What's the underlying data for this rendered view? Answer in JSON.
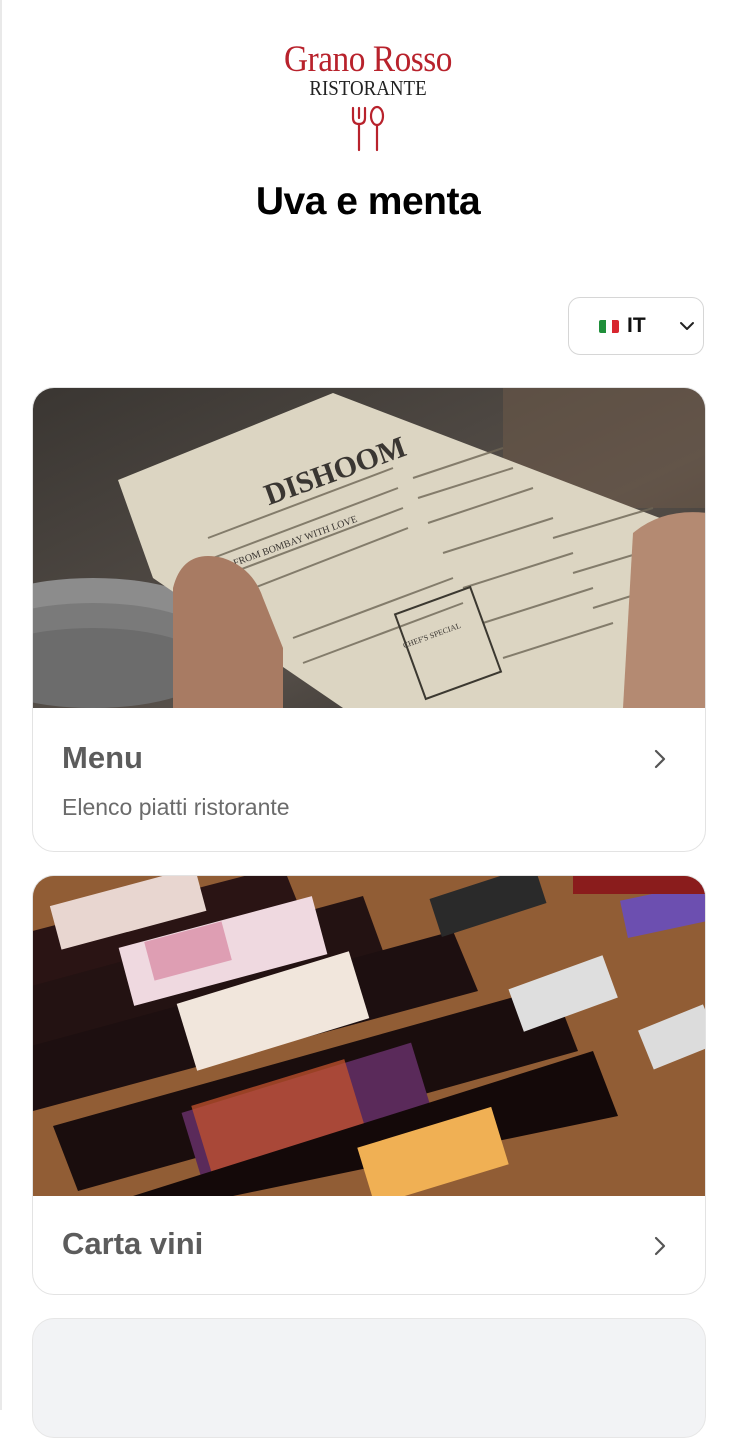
{
  "brand": {
    "name": "Grano Rosso",
    "subtitle": "RISTORANTE",
    "color": "#b8222c"
  },
  "page": {
    "title": "Uva e menta"
  },
  "language": {
    "selected": "IT",
    "flag": "italy-flag-icon"
  },
  "cards": [
    {
      "title": "Menu",
      "description": "Elenco piatti ristorante",
      "image": "menu-photo",
      "image_text": {
        "logo": "DISHOOM",
        "tagline": "FROM BOMBAY WITH LOVE",
        "special": "CHEF'S SPECIAL"
      },
      "icon": "chevron-right-icon"
    },
    {
      "title": "Carta vini",
      "image": "wine-bottles-photo",
      "icon": "chevron-right-icon"
    },
    {
      "title": ""
    }
  ]
}
